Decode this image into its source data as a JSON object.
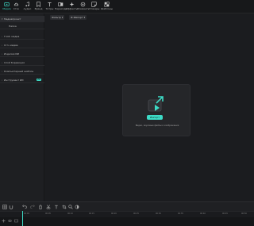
{
  "toolbar": {
    "items": [
      {
        "icon": "media-icon",
        "label": "Медиа"
      },
      {
        "icon": "cloud-icon",
        "label": "Сток"
      },
      {
        "icon": "music-icon",
        "label": "Аудио"
      },
      {
        "icon": "brand-icon",
        "label": "Бренд"
      },
      {
        "icon": "text-icon",
        "label": "Титры"
      },
      {
        "icon": "transition-icon",
        "label": "Переходы"
      },
      {
        "icon": "effects-icon",
        "label": "Эффекты"
      },
      {
        "icon": "elements-icon",
        "label": "Элементы"
      },
      {
        "icon": "stickers-icon",
        "label": "Стикеры"
      },
      {
        "icon": "templates-icon",
        "label": "Шаблоны"
      }
    ],
    "active_index": 0
  },
  "sidebar": {
    "items": [
      {
        "label": "Медиапроект",
        "selected": true,
        "caret": "▾"
      },
      {
        "label": "Папка",
        "selected": false,
        "caret": ""
      },
      {
        "label": "Глоб. медиа",
        "selected": false,
        "caret": "›"
      },
      {
        "label": "Сгл. медиа",
        "selected": false,
        "caret": "›"
      },
      {
        "label": "Изделия ИИ",
        "selected": false,
        "caret": "›"
      },
      {
        "label": "Слой Коррекция",
        "selected": false,
        "caret": "›"
      },
      {
        "label": "Компьютерный шаблон",
        "selected": false,
        "caret": "›"
      },
      {
        "label": "Инструмент ИИ",
        "selected": false,
        "caret": "›",
        "badge": "ИИ"
      }
    ]
  },
  "main": {
    "filters": [
      {
        "label": "Фильтр"
      },
      {
        "label": "Импорт"
      }
    ],
    "import_card": {
      "button_label": "Импорт",
      "hint": "Видео, звуковые файлы и изображения"
    }
  },
  "timeline": {
    "ticks": [
      "00:00",
      "00:05",
      "00:10",
      "00:15",
      "00:20",
      "00:25",
      "00:30",
      "00:35",
      "00:40",
      "00:45",
      "00:50",
      "00:55"
    ]
  },
  "colors": {
    "accent": "#3ddbc6",
    "background": "#1c1d20"
  }
}
